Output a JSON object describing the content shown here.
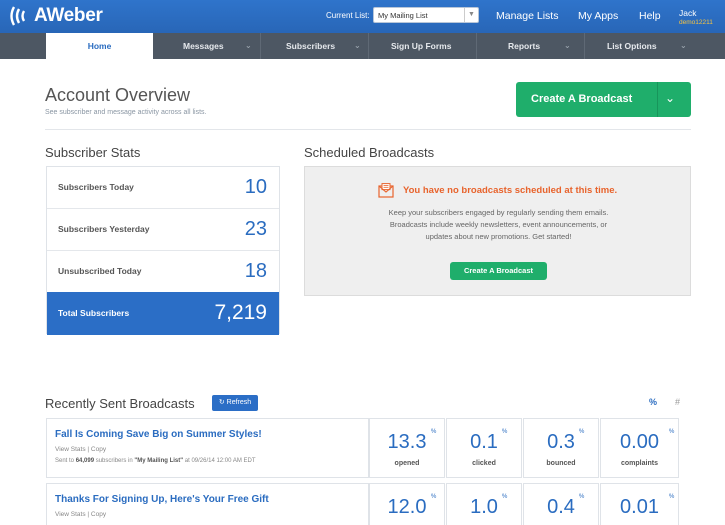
{
  "app": {
    "logo_text": "AWeber",
    "current_list_label": "Current List:",
    "current_list_value": "My Mailing List",
    "links": [
      "Manage Lists",
      "My Apps",
      "Help"
    ],
    "user_name": "Jack",
    "user_id": "demo12211"
  },
  "nav": {
    "items": [
      {
        "label": "Home"
      },
      {
        "label": "Messages"
      },
      {
        "label": "Subscribers"
      },
      {
        "label": "Sign Up Forms"
      },
      {
        "label": "Reports"
      },
      {
        "label": "List Options"
      }
    ]
  },
  "header": {
    "title": "Account Overview",
    "subtitle": "See subscriber and message activity across all lists.",
    "create_button": "Create A Broadcast"
  },
  "stats": {
    "title": "Subscriber Stats",
    "rows": [
      {
        "label": "Subscribers Today",
        "value": "10"
      },
      {
        "label": "Subscribers Yesterday",
        "value": "23"
      },
      {
        "label": "Unsubscribed Today",
        "value": "18"
      },
      {
        "label": "Total Subscribers",
        "value": "7,219"
      }
    ]
  },
  "scheduled": {
    "title": "Scheduled Broadcasts",
    "warning": "You have no broadcasts scheduled at this time.",
    "text_line1": "Keep your subscribers engaged by regularly sending them emails.",
    "text_line2": "Broadcasts include weekly newsletters, event announcements, or",
    "text_line3": "updates about new promotions. Get started!",
    "button": "Create A Broadcast"
  },
  "recent": {
    "title": "Recently Sent Broadcasts",
    "refresh": "Refresh",
    "toggle_percent": "%",
    "toggle_count": "#",
    "broadcasts": [
      {
        "title": "Fall Is Coming Save Big on Summer Styles!",
        "links": "View Stats | Copy",
        "sent_prefix": "Sent to ",
        "sent_count": "64,099",
        "sent_mid": " subscribers in ",
        "sent_list": "\"My Mailing List\"",
        "sent_suffix": " at 09/26/14 12:00 AM EDT",
        "metrics": [
          {
            "value": "13.3",
            "caption": "opened"
          },
          {
            "value": "0.1",
            "caption": "clicked"
          },
          {
            "value": "0.3",
            "caption": "bounced"
          },
          {
            "value": "0.00",
            "caption": "complaints"
          }
        ]
      },
      {
        "title": "Thanks For Signing Up, Here's Your Free Gift",
        "links": "View Stats | Copy",
        "metrics": [
          {
            "value": "12.0",
            "caption": ""
          },
          {
            "value": "1.0",
            "caption": ""
          },
          {
            "value": "0.4",
            "caption": ""
          },
          {
            "value": "0.01",
            "caption": ""
          }
        ]
      }
    ],
    "percent_sign": "%"
  },
  "colors": {
    "brand_blue": "#2b6ec6",
    "nav_gray": "#4d5763",
    "action_green": "#1fae6b",
    "warning_orange": "#e8632c"
  }
}
